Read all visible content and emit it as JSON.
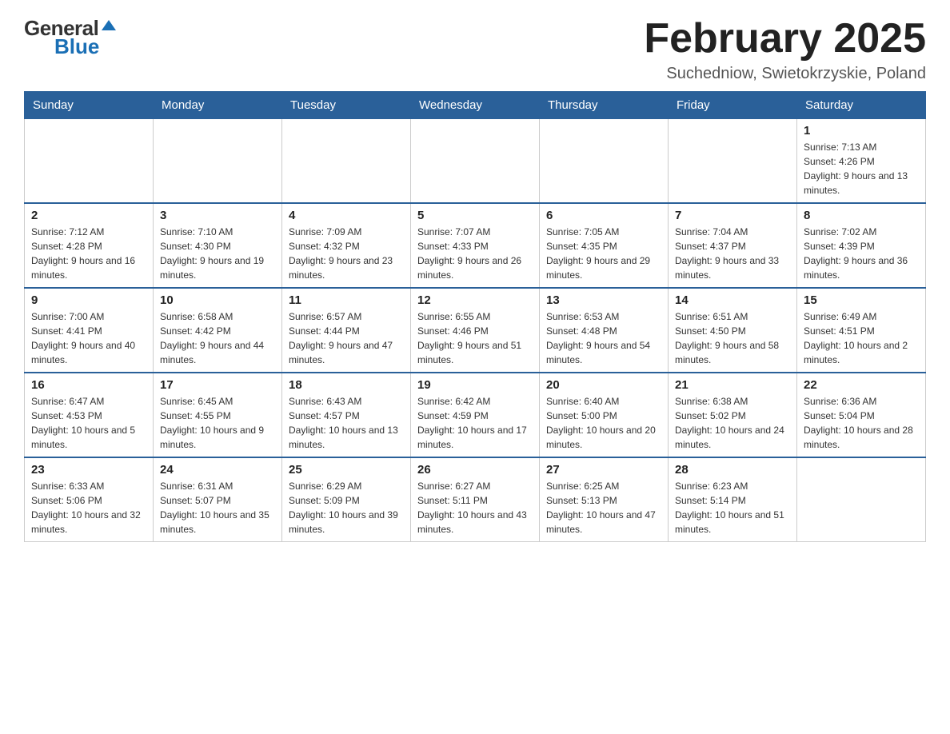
{
  "header": {
    "logo_general": "General",
    "logo_blue": "Blue",
    "title": "February 2025",
    "subtitle": "Suchedniow, Swietokrzyskie, Poland"
  },
  "weekdays": [
    "Sunday",
    "Monday",
    "Tuesday",
    "Wednesday",
    "Thursday",
    "Friday",
    "Saturday"
  ],
  "weeks": [
    [
      {
        "day": "",
        "info": ""
      },
      {
        "day": "",
        "info": ""
      },
      {
        "day": "",
        "info": ""
      },
      {
        "day": "",
        "info": ""
      },
      {
        "day": "",
        "info": ""
      },
      {
        "day": "",
        "info": ""
      },
      {
        "day": "1",
        "info": "Sunrise: 7:13 AM\nSunset: 4:26 PM\nDaylight: 9 hours and 13 minutes."
      }
    ],
    [
      {
        "day": "2",
        "info": "Sunrise: 7:12 AM\nSunset: 4:28 PM\nDaylight: 9 hours and 16 minutes."
      },
      {
        "day": "3",
        "info": "Sunrise: 7:10 AM\nSunset: 4:30 PM\nDaylight: 9 hours and 19 minutes."
      },
      {
        "day": "4",
        "info": "Sunrise: 7:09 AM\nSunset: 4:32 PM\nDaylight: 9 hours and 23 minutes."
      },
      {
        "day": "5",
        "info": "Sunrise: 7:07 AM\nSunset: 4:33 PM\nDaylight: 9 hours and 26 minutes."
      },
      {
        "day": "6",
        "info": "Sunrise: 7:05 AM\nSunset: 4:35 PM\nDaylight: 9 hours and 29 minutes."
      },
      {
        "day": "7",
        "info": "Sunrise: 7:04 AM\nSunset: 4:37 PM\nDaylight: 9 hours and 33 minutes."
      },
      {
        "day": "8",
        "info": "Sunrise: 7:02 AM\nSunset: 4:39 PM\nDaylight: 9 hours and 36 minutes."
      }
    ],
    [
      {
        "day": "9",
        "info": "Sunrise: 7:00 AM\nSunset: 4:41 PM\nDaylight: 9 hours and 40 minutes."
      },
      {
        "day": "10",
        "info": "Sunrise: 6:58 AM\nSunset: 4:42 PM\nDaylight: 9 hours and 44 minutes."
      },
      {
        "day": "11",
        "info": "Sunrise: 6:57 AM\nSunset: 4:44 PM\nDaylight: 9 hours and 47 minutes."
      },
      {
        "day": "12",
        "info": "Sunrise: 6:55 AM\nSunset: 4:46 PM\nDaylight: 9 hours and 51 minutes."
      },
      {
        "day": "13",
        "info": "Sunrise: 6:53 AM\nSunset: 4:48 PM\nDaylight: 9 hours and 54 minutes."
      },
      {
        "day": "14",
        "info": "Sunrise: 6:51 AM\nSunset: 4:50 PM\nDaylight: 9 hours and 58 minutes."
      },
      {
        "day": "15",
        "info": "Sunrise: 6:49 AM\nSunset: 4:51 PM\nDaylight: 10 hours and 2 minutes."
      }
    ],
    [
      {
        "day": "16",
        "info": "Sunrise: 6:47 AM\nSunset: 4:53 PM\nDaylight: 10 hours and 5 minutes."
      },
      {
        "day": "17",
        "info": "Sunrise: 6:45 AM\nSunset: 4:55 PM\nDaylight: 10 hours and 9 minutes."
      },
      {
        "day": "18",
        "info": "Sunrise: 6:43 AM\nSunset: 4:57 PM\nDaylight: 10 hours and 13 minutes."
      },
      {
        "day": "19",
        "info": "Sunrise: 6:42 AM\nSunset: 4:59 PM\nDaylight: 10 hours and 17 minutes."
      },
      {
        "day": "20",
        "info": "Sunrise: 6:40 AM\nSunset: 5:00 PM\nDaylight: 10 hours and 20 minutes."
      },
      {
        "day": "21",
        "info": "Sunrise: 6:38 AM\nSunset: 5:02 PM\nDaylight: 10 hours and 24 minutes."
      },
      {
        "day": "22",
        "info": "Sunrise: 6:36 AM\nSunset: 5:04 PM\nDaylight: 10 hours and 28 minutes."
      }
    ],
    [
      {
        "day": "23",
        "info": "Sunrise: 6:33 AM\nSunset: 5:06 PM\nDaylight: 10 hours and 32 minutes."
      },
      {
        "day": "24",
        "info": "Sunrise: 6:31 AM\nSunset: 5:07 PM\nDaylight: 10 hours and 35 minutes."
      },
      {
        "day": "25",
        "info": "Sunrise: 6:29 AM\nSunset: 5:09 PM\nDaylight: 10 hours and 39 minutes."
      },
      {
        "day": "26",
        "info": "Sunrise: 6:27 AM\nSunset: 5:11 PM\nDaylight: 10 hours and 43 minutes."
      },
      {
        "day": "27",
        "info": "Sunrise: 6:25 AM\nSunset: 5:13 PM\nDaylight: 10 hours and 47 minutes."
      },
      {
        "day": "28",
        "info": "Sunrise: 6:23 AM\nSunset: 5:14 PM\nDaylight: 10 hours and 51 minutes."
      },
      {
        "day": "",
        "info": ""
      }
    ]
  ]
}
